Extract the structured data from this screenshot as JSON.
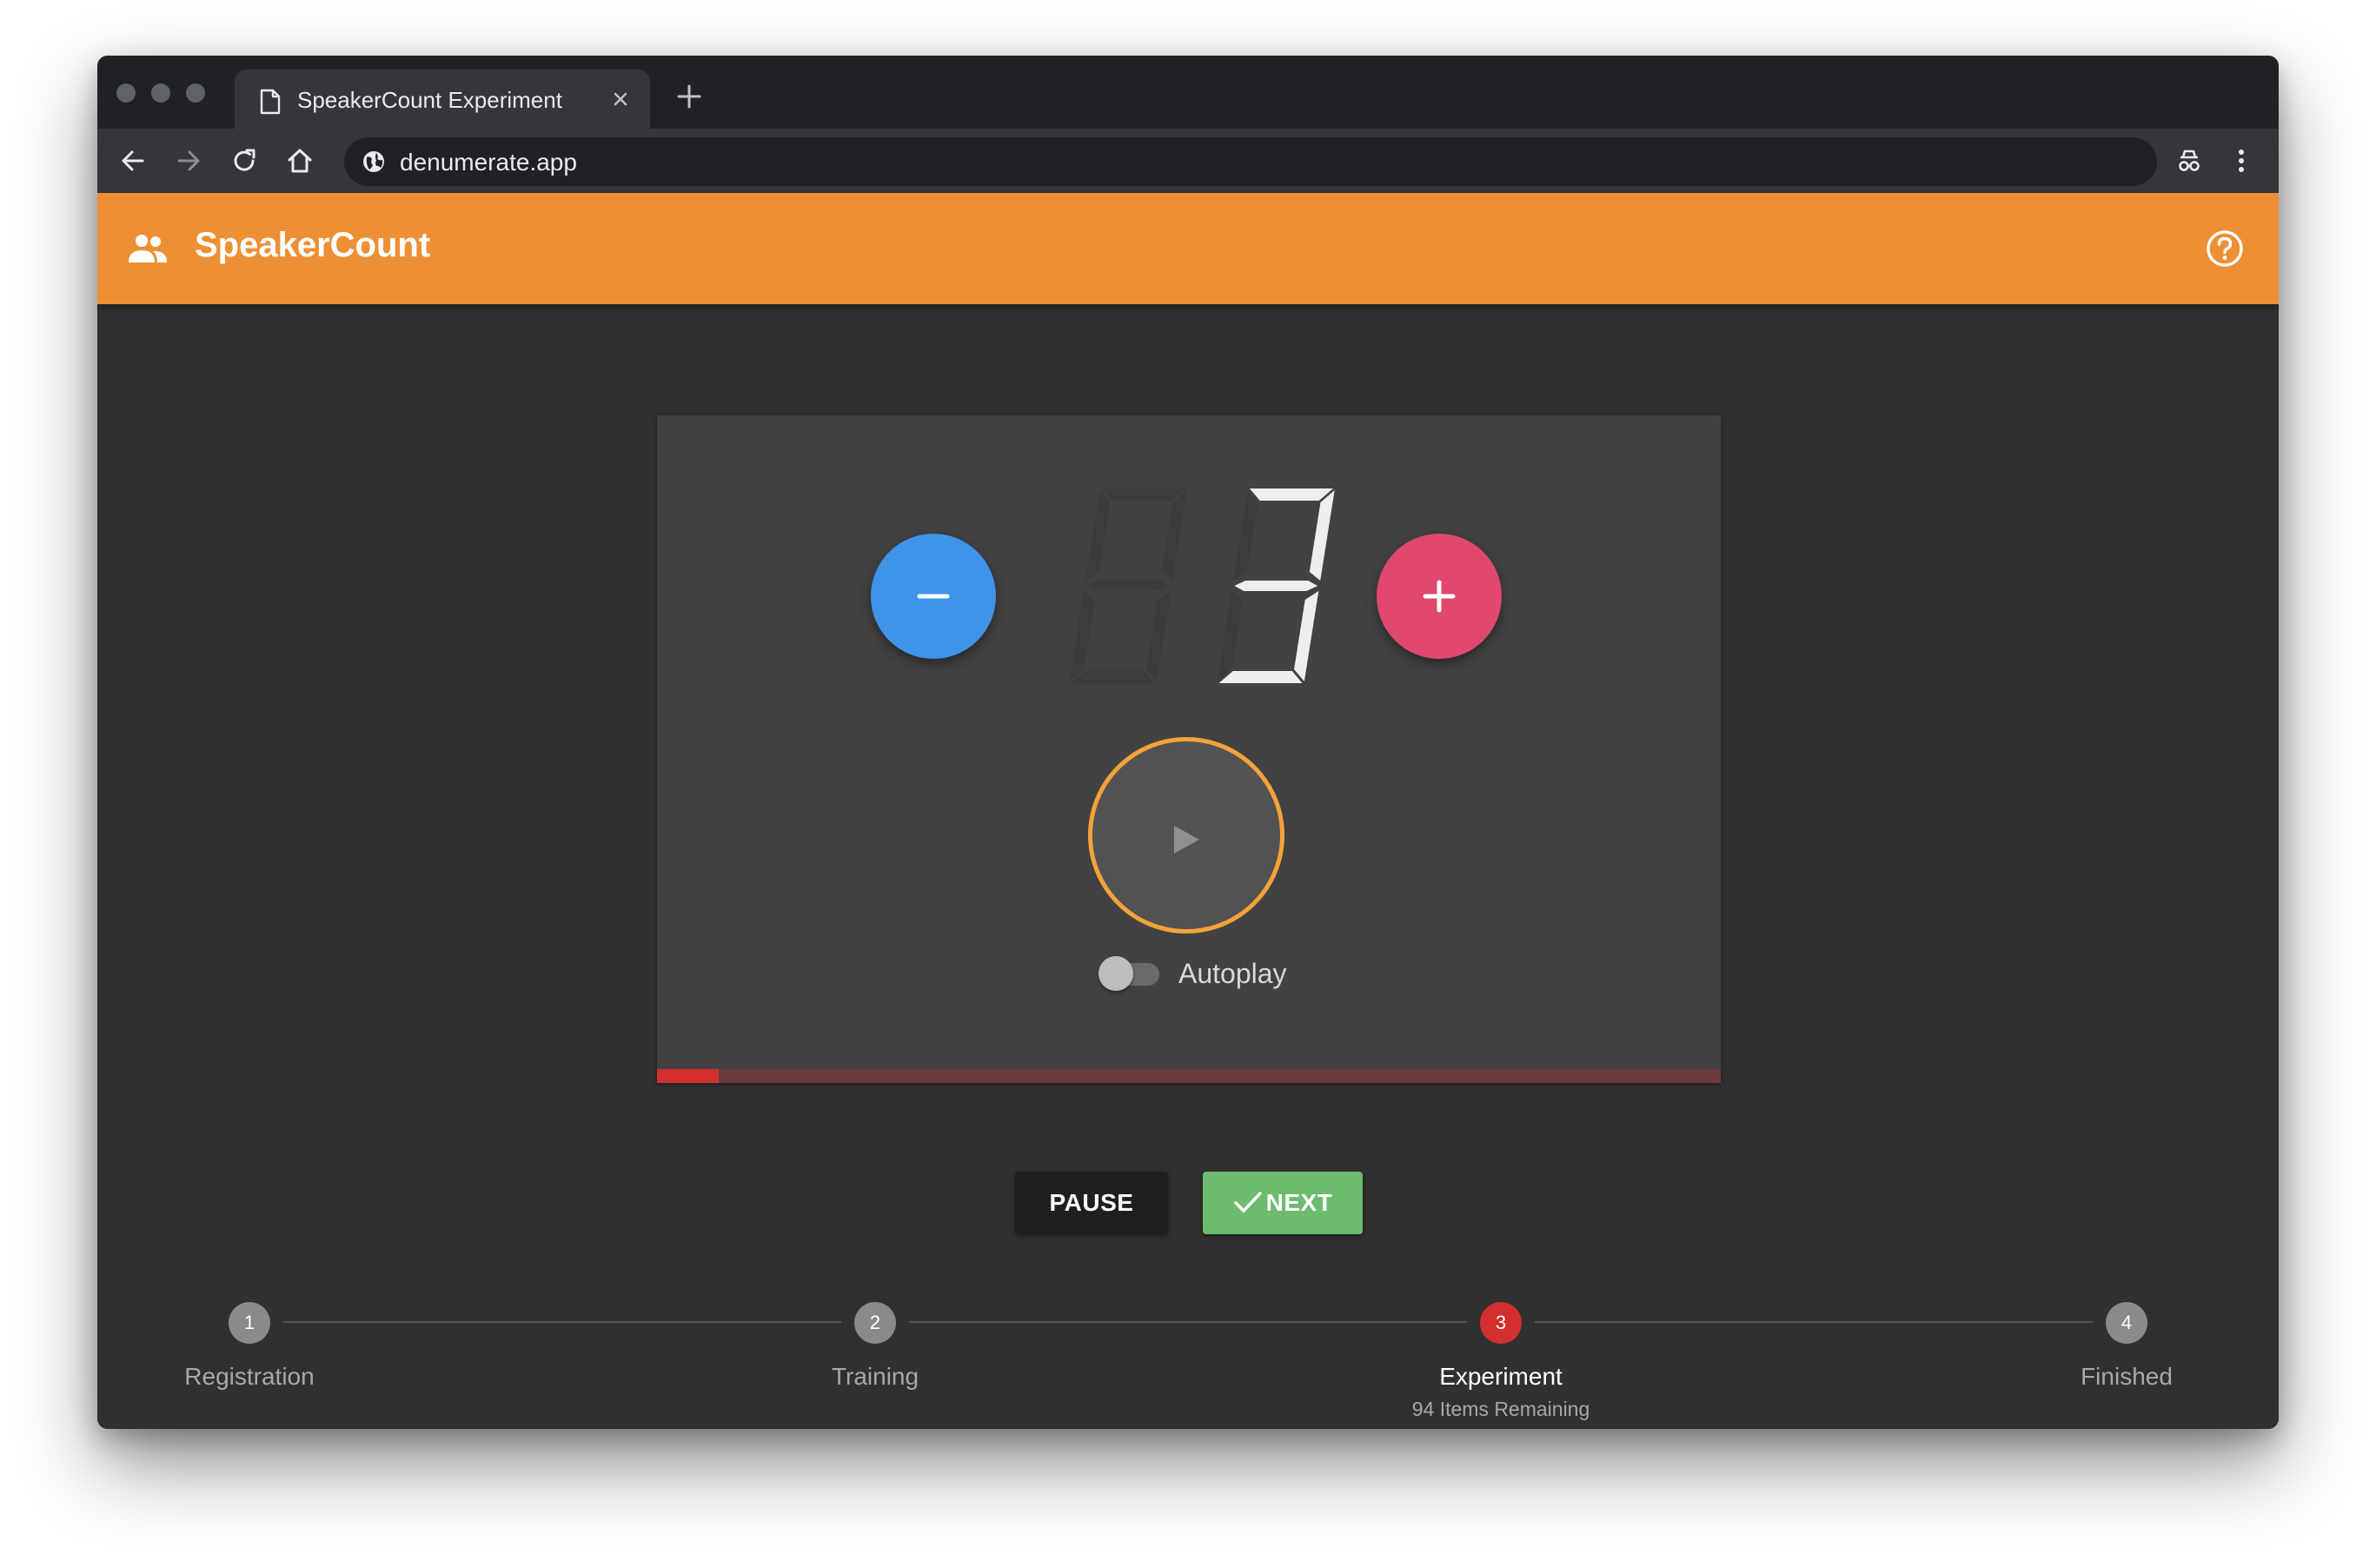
{
  "browser": {
    "tab_title": "SpeakerCount Experiment",
    "url": "denumerate.app"
  },
  "app": {
    "title": "SpeakerCount"
  },
  "counter": {
    "value": 3,
    "digits": [
      "",
      "3"
    ]
  },
  "controls": {
    "autoplay_label": "Autoplay",
    "autoplay_on": false,
    "progress": 0.058,
    "pause_label": "PAUSE",
    "next_label": "NEXT"
  },
  "stepper": {
    "steps": [
      {
        "number": "1",
        "label": "Registration",
        "sub": ""
      },
      {
        "number": "2",
        "label": "Training",
        "sub": ""
      },
      {
        "number": "3",
        "label": "Experiment",
        "sub": "94 Items Remaining"
      },
      {
        "number": "4",
        "label": "Finished",
        "sub": ""
      }
    ],
    "active_index": 2
  },
  "colors": {
    "appbar": "#ed9035",
    "minus_button": "#3f94e9",
    "plus_button": "#e0486f",
    "play_ring": "#f4a239",
    "progress_fill": "#d32f2f",
    "next_button": "#6dbb6e",
    "active_step": "#d32f2f"
  },
  "icons": {
    "tab": "document-icon",
    "close": "close-icon",
    "new_tab": "plus-icon",
    "back": "arrow-left-icon",
    "forward": "arrow-right-icon",
    "reload": "reload-icon",
    "home": "home-icon",
    "site": "globe-icon",
    "incognito": "incognito-icon",
    "menu": "kebab-menu-icon",
    "app": "people-icon",
    "help": "help-circle-icon",
    "play": "play-icon",
    "check": "check-icon"
  }
}
